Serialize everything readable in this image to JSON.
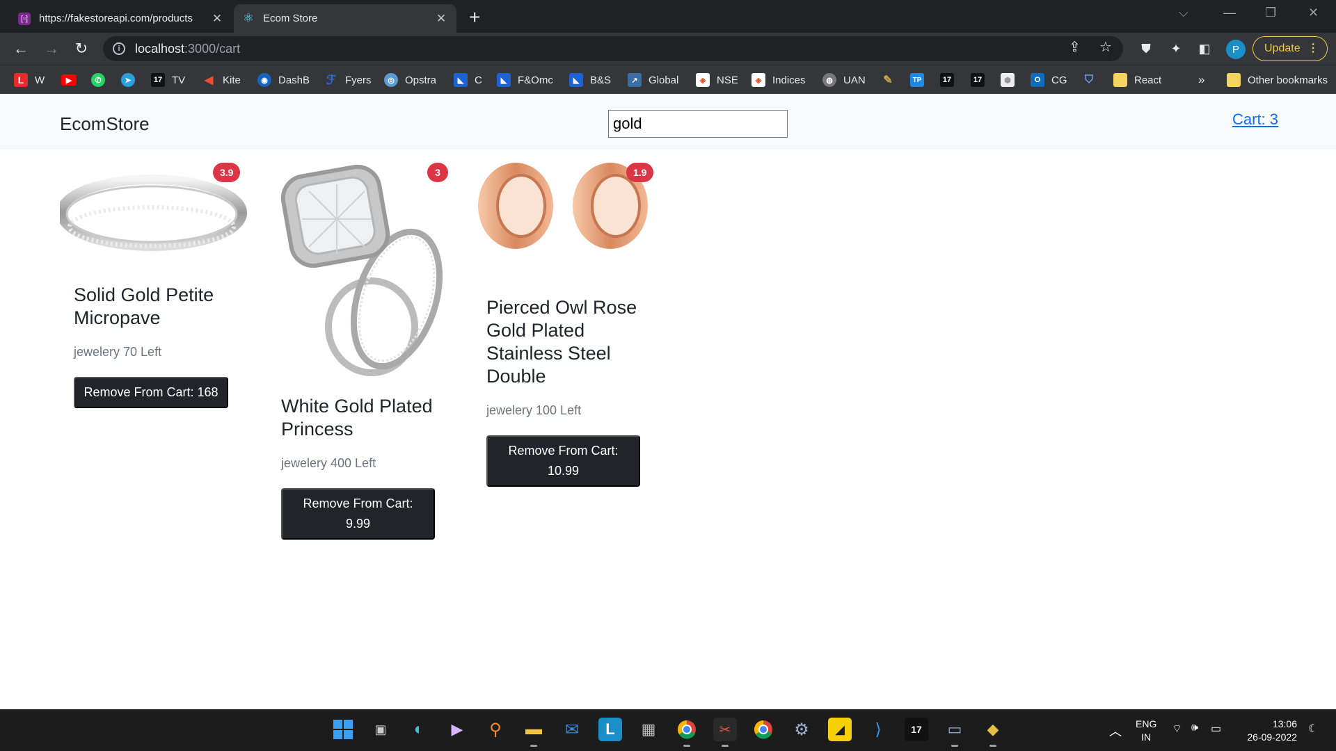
{
  "browser": {
    "tabs": [
      {
        "title": "https://fakestoreapi.com/products",
        "active": false
      },
      {
        "title": "Ecom Store",
        "active": true
      }
    ],
    "address": {
      "host": "localhost",
      "path": ":3000/cart"
    },
    "profile_initial": "P",
    "update_label": "Update",
    "bookmarks": [
      {
        "label": "W",
        "icon": "L-icon"
      },
      {
        "label": "",
        "icon": "youtube-icon"
      },
      {
        "label": "",
        "icon": "whatsapp-icon"
      },
      {
        "label": "",
        "icon": "telegram-icon"
      },
      {
        "label": "TV",
        "icon": "tradingview-icon"
      },
      {
        "label": "Kite",
        "icon": "kite-icon"
      },
      {
        "label": "DashB",
        "icon": "dashb-icon"
      },
      {
        "label": "Fyers",
        "icon": "fyers-icon"
      },
      {
        "label": "Opstra",
        "icon": "opstra-icon"
      },
      {
        "label": "C",
        "icon": "folder-icon"
      },
      {
        "label": "F&Omc",
        "icon": "folder-icon"
      },
      {
        "label": "B&S",
        "icon": "folder-icon"
      },
      {
        "label": "Global",
        "icon": "chart-icon"
      },
      {
        "label": "NSE",
        "icon": "nse-icon"
      },
      {
        "label": "Indices",
        "icon": "nse-icon"
      },
      {
        "label": "UAN",
        "icon": "globe-icon"
      },
      {
        "label": "",
        "icon": "pen-icon"
      },
      {
        "label": "",
        "icon": "tp-icon"
      },
      {
        "label": "",
        "icon": "tradingview-icon"
      },
      {
        "label": "",
        "icon": "tradingview-icon"
      },
      {
        "label": "",
        "icon": "cube-icon"
      },
      {
        "label": "CG",
        "icon": "outlook-icon"
      },
      {
        "label": "",
        "icon": "shield-icon"
      },
      {
        "label": "React",
        "icon": "bookmark-folder-icon"
      }
    ],
    "bookmarks_overflow": "»",
    "other_bookmarks": "Other bookmarks"
  },
  "page": {
    "brand": "EcomStore",
    "search": {
      "value": "gold"
    },
    "cart_link": "Cart: 3",
    "products": [
      {
        "title": "Solid Gold Petite Micropave",
        "category_stock": "jewelery 70 Left",
        "rating": "3.9",
        "button": "Remove From Cart: 168"
      },
      {
        "title": "White Gold Plated Princess",
        "category_stock": "jewelery 400 Left",
        "rating": "3",
        "button": "Remove From Cart: 9.99"
      },
      {
        "title": "Pierced Owl Rose Gold Plated Stainless Steel Double",
        "category_stock": "jewelery 100 Left",
        "rating": "1.9",
        "button": "Remove From Cart: 10.99"
      }
    ]
  },
  "taskbar": {
    "lang": "ENG",
    "region": "IN",
    "time": "13:06",
    "date": "26-09-2022"
  },
  "colors": {
    "accent_blue": "#0d6efd",
    "badge_red": "#dc3545",
    "button_dark": "#212529",
    "update_yellow": "#f2c94c"
  }
}
